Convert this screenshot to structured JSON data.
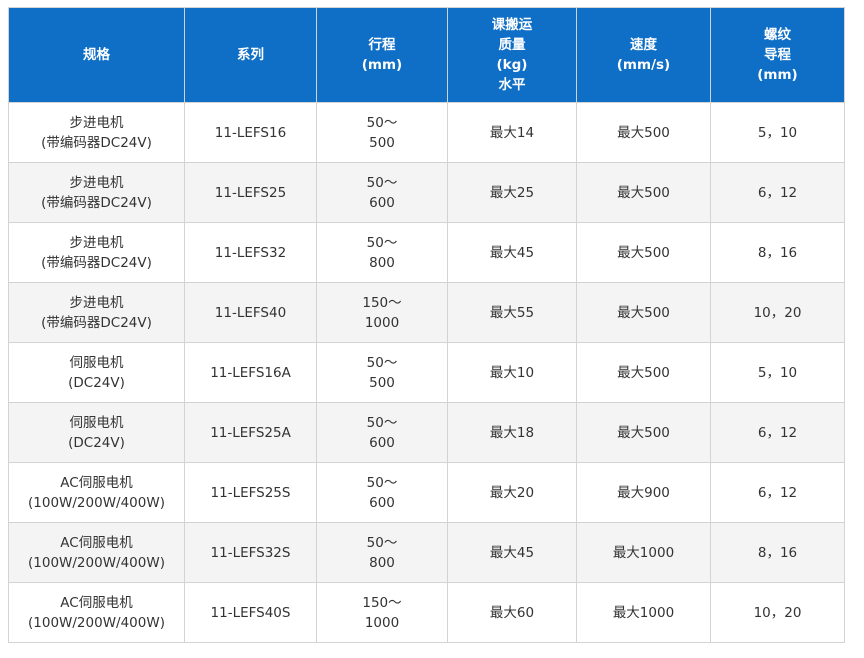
{
  "table": {
    "headers": [
      "规格",
      "系列",
      "行程\n(mm)",
      "课搬运\n质量\n(kg)\n水平",
      "速度\n(mm/s)",
      "螺纹\n导程\n(mm)"
    ],
    "rows": [
      [
        "步进电机\n(带编码器DC24V)",
        "11-LEFS16",
        "50～\n500",
        "最大14",
        "最大500",
        "5，10"
      ],
      [
        "步进电机\n(带编码器DC24V)",
        "11-LEFS25",
        "50～\n600",
        "最大25",
        "最大500",
        "6，12"
      ],
      [
        "步进电机\n(带编码器DC24V)",
        "11-LEFS32",
        "50～\n800",
        "最大45",
        "最大500",
        "8，16"
      ],
      [
        "步进电机\n(带编码器DC24V)",
        "11-LEFS40",
        "150～\n1000",
        "最大55",
        "最大500",
        "10，20"
      ],
      [
        "伺服电机\n(DC24V)",
        "11-LEFS16A",
        "50～\n500",
        "最大10",
        "最大500",
        "5，10"
      ],
      [
        "伺服电机\n(DC24V)",
        "11-LEFS25A",
        "50～\n600",
        "最大18",
        "最大500",
        "6，12"
      ],
      [
        "AC伺服电机\n(100W/200W/400W)",
        "11-LEFS25S",
        "50～\n600",
        "最大20",
        "最大900",
        "6，12"
      ],
      [
        "AC伺服电机\n(100W/200W/400W)",
        "11-LEFS32S",
        "50～\n800",
        "最大45",
        "最大1000",
        "8，16"
      ],
      [
        "AC伺服电机\n(100W/200W/400W)",
        "11-LEFS40S",
        "150～\n1000",
        "最大60",
        "最大1000",
        "10，20"
      ]
    ]
  },
  "colors": {
    "header_bg": "#0f6fc6",
    "header_text": "#ffffff",
    "row_alt_bg": "#f4f4f4",
    "border": "#d3d3d3",
    "body_text": "#333333"
  }
}
